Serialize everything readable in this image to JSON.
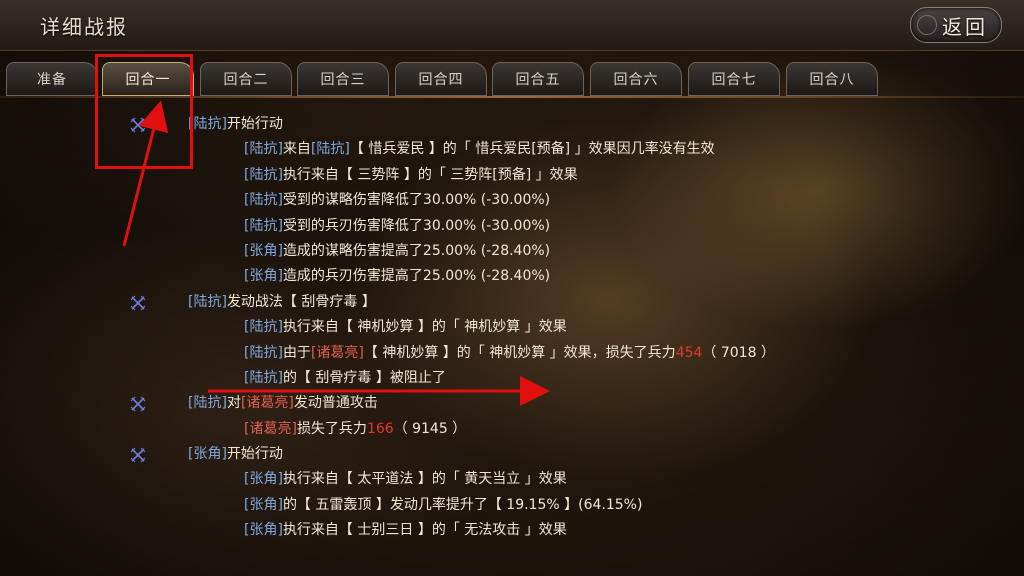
{
  "header": {
    "title": "详细战报",
    "back_label": "返回"
  },
  "tabs": [
    {
      "label": "准备",
      "active": false
    },
    {
      "label": "回合一",
      "active": true
    },
    {
      "label": "回合二",
      "active": false
    },
    {
      "label": "回合三",
      "active": false
    },
    {
      "label": "回合四",
      "active": false
    },
    {
      "label": "回合五",
      "active": false
    },
    {
      "label": "回合六",
      "active": false
    },
    {
      "label": "回合七",
      "active": false
    },
    {
      "label": "回合八",
      "active": false
    }
  ],
  "log": [
    {
      "level": 1,
      "bullet": true,
      "parts": [
        [
          "[陆抗]",
          "blue"
        ],
        [
          "开始行动",
          "txt"
        ]
      ]
    },
    {
      "level": 2,
      "parts": [
        [
          "[陆抗]",
          "blue"
        ],
        [
          "来自",
          "txt"
        ],
        [
          "[陆抗]",
          "blue"
        ],
        [
          "【 惜兵爱民 】的「 惜兵爱民[预备] 」效果因几率没有生效",
          "txt"
        ]
      ]
    },
    {
      "level": 2,
      "parts": [
        [
          "[陆抗]",
          "blue"
        ],
        [
          "执行来自【 三势阵 】的「 三势阵[预备] 」效果",
          "txt"
        ]
      ]
    },
    {
      "level": 2,
      "parts": [
        [
          "[陆抗]",
          "blue"
        ],
        [
          "受到的谋略伤害降低了30.00% (-30.00%)",
          "txt"
        ]
      ]
    },
    {
      "level": 2,
      "parts": [
        [
          "[陆抗]",
          "blue"
        ],
        [
          "受到的兵刃伤害降低了30.00% (-30.00%)",
          "txt"
        ]
      ]
    },
    {
      "level": 2,
      "parts": [
        [
          "[张角]",
          "blue"
        ],
        [
          "造成的谋略伤害提高了25.00% (-28.40%)",
          "txt"
        ]
      ]
    },
    {
      "level": 2,
      "parts": [
        [
          "[张角]",
          "blue"
        ],
        [
          "造成的兵刃伤害提高了25.00% (-28.40%)",
          "txt"
        ]
      ]
    },
    {
      "level": 1,
      "bullet": true,
      "parts": [
        [
          "[陆抗]",
          "blue"
        ],
        [
          "发动战法【 刮骨疗毒 】",
          "txt"
        ]
      ]
    },
    {
      "level": 2,
      "parts": [
        [
          "[陆抗]",
          "blue"
        ],
        [
          "执行来自【 神机妙算 】的「 神机妙算 」效果",
          "txt"
        ]
      ]
    },
    {
      "level": 2,
      "parts": [
        [
          "[陆抗]",
          "blue"
        ],
        [
          "由于",
          "txt"
        ],
        [
          "[诸葛亮]",
          "red"
        ],
        [
          "【 神机妙算 】的「 神机妙算 」效果，损失了兵力",
          "txt"
        ],
        [
          "454",
          "num"
        ],
        [
          "（ 7018 ）",
          "txt"
        ]
      ]
    },
    {
      "level": 2,
      "parts": [
        [
          "[陆抗]",
          "blue"
        ],
        [
          "的【 刮骨疗毒 】被阻止了",
          "txt"
        ]
      ]
    },
    {
      "level": 1,
      "bullet": true,
      "parts": [
        [
          "[陆抗]",
          "blue"
        ],
        [
          "对",
          "txt"
        ],
        [
          "[诸葛亮]",
          "red"
        ],
        [
          "发动普通攻击",
          "txt"
        ]
      ]
    },
    {
      "level": 2,
      "parts": [
        [
          "[诸葛亮]",
          "red"
        ],
        [
          "损失了兵力",
          "txt"
        ],
        [
          "166",
          "num"
        ],
        [
          "（ 9145 ）",
          "txt"
        ]
      ]
    },
    {
      "level": 1,
      "bullet": true,
      "parts": [
        [
          "[张角]",
          "blue"
        ],
        [
          "开始行动",
          "txt"
        ]
      ]
    },
    {
      "level": 2,
      "parts": [
        [
          "[张角]",
          "blue"
        ],
        [
          "执行来自【 太平道法 】的「 黄天当立 」效果",
          "txt"
        ]
      ]
    },
    {
      "level": 2,
      "parts": [
        [
          "[张角]",
          "blue"
        ],
        [
          "的【 五雷轰顶 】发动几率提升了【 19.15% 】(64.15%)",
          "txt"
        ]
      ]
    },
    {
      "level": 2,
      "parts": [
        [
          "[张角]",
          "blue"
        ],
        [
          "执行来自【 士别三日 】的「 无法攻击 」效果",
          "txt"
        ]
      ]
    }
  ],
  "colors": {
    "name_blue": "#7fa8de",
    "name_red": "#e06050",
    "loss_red": "#e03a2a",
    "text": "#f1e7d4",
    "annotation_red": "#e01010"
  },
  "icons": {
    "bullet": "crossed-swords-icon",
    "back": "back-icon"
  }
}
